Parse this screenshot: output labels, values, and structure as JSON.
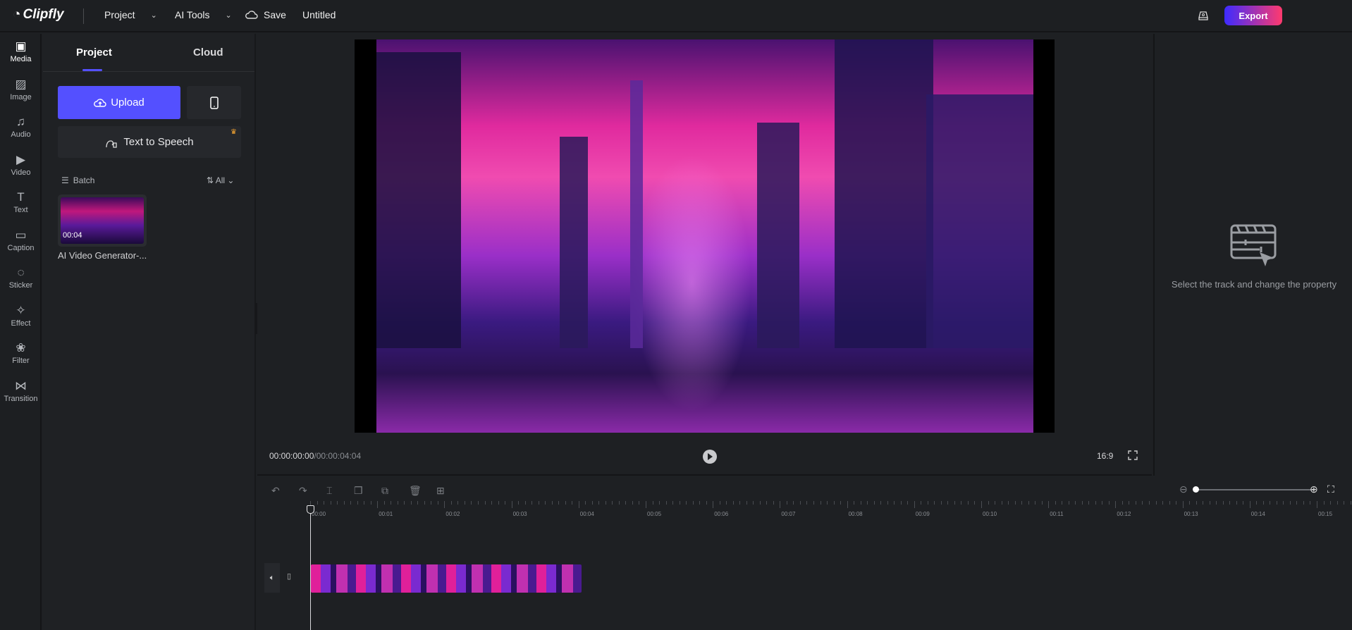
{
  "topbar": {
    "logo": "Clipfly",
    "project": "Project",
    "ai_tools": "AI Tools",
    "save": "Save",
    "title": "Untitled",
    "export": "Export"
  },
  "rail": [
    {
      "label": "Media"
    },
    {
      "label": "Image"
    },
    {
      "label": "Audio"
    },
    {
      "label": "Video"
    },
    {
      "label": "Text"
    },
    {
      "label": "Caption"
    },
    {
      "label": "Sticker"
    },
    {
      "label": "Effect"
    },
    {
      "label": "Filter"
    },
    {
      "label": "Transition"
    }
  ],
  "panel": {
    "tabs": [
      "Project",
      "Cloud"
    ],
    "upload": "Upload",
    "tts": "Text to Speech",
    "batch": "Batch",
    "filter": "All",
    "media": [
      {
        "duration": "00:04",
        "name": "AI Video Generator-..."
      }
    ]
  },
  "preview": {
    "current": "00:00:00:00",
    "total": "/00:00:04:04",
    "ratio": "16:9"
  },
  "properties": {
    "empty_text": "Select the track and change the property"
  },
  "timeline": {
    "ruler": [
      "00:00",
      "00:01",
      "00:02",
      "00:03",
      "00:04",
      "00:05",
      "00:06",
      "00:07",
      "00:08",
      "00:09",
      "00:10",
      "00:11",
      "00:12",
      "00:13",
      "00:14",
      "00:15"
    ],
    "zoom_level": 0.02
  },
  "colors": {
    "accent": "#5450ff",
    "export_from": "#3d2bff",
    "export_to": "#ff3a6e"
  }
}
